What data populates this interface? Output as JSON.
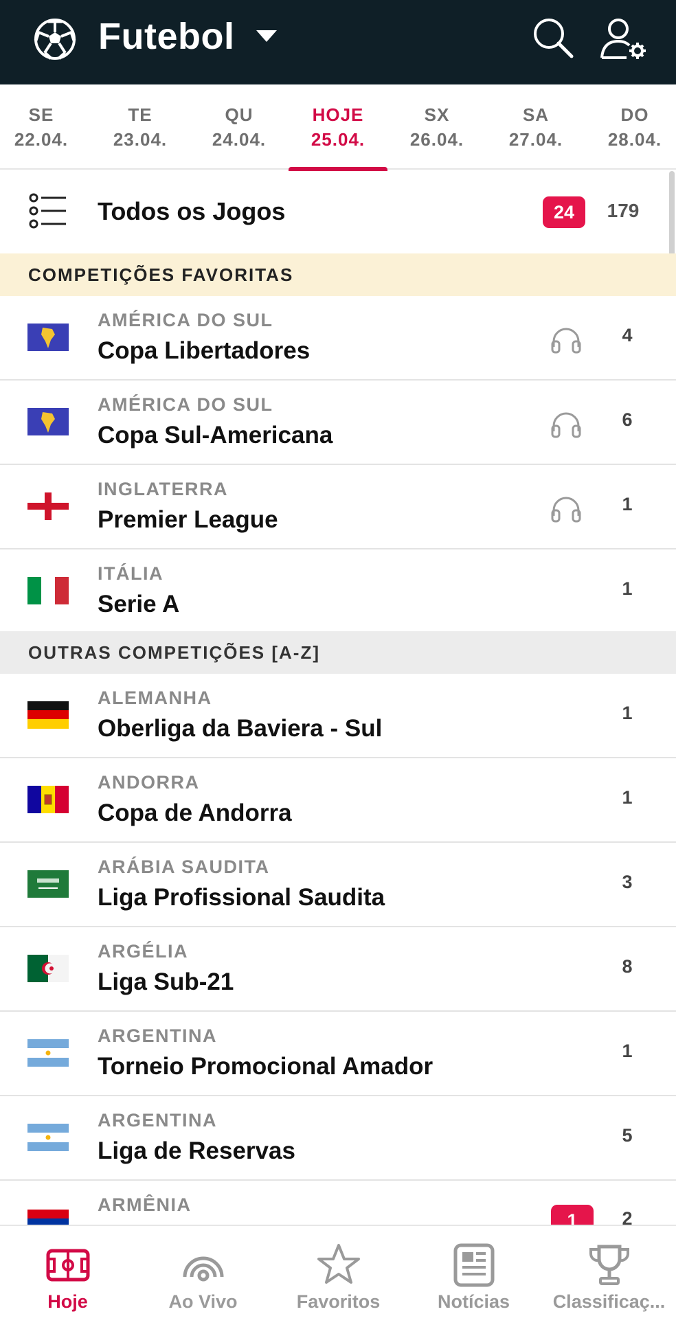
{
  "header": {
    "title": "Futebol"
  },
  "dates": [
    {
      "weekday": "SE",
      "date": "22.04.",
      "active": false
    },
    {
      "weekday": "TE",
      "date": "23.04.",
      "active": false
    },
    {
      "weekday": "QU",
      "date": "24.04.",
      "active": false
    },
    {
      "weekday": "HOJE",
      "date": "25.04.",
      "active": true
    },
    {
      "weekday": "SX",
      "date": "26.04.",
      "active": false
    },
    {
      "weekday": "SA",
      "date": "27.04.",
      "active": false
    },
    {
      "weekday": "DO",
      "date": "28.04.",
      "active": false
    }
  ],
  "all_games": {
    "label": "Todos os Jogos",
    "live": "24",
    "total": "179"
  },
  "favorites": {
    "title": "COMPETIÇÕES FAVORITAS",
    "items": [
      {
        "country": "AMÉRICA DO SUL",
        "name": "Copa Libertadores",
        "count": "4",
        "audio": true,
        "flag": "south-america"
      },
      {
        "country": "AMÉRICA DO SUL",
        "name": "Copa Sul-Americana",
        "count": "6",
        "audio": true,
        "flag": "south-america"
      },
      {
        "country": "INGLATERRA",
        "name": "Premier League",
        "count": "1",
        "audio": true,
        "flag": "england"
      },
      {
        "country": "ITÁLIA",
        "name": "Serie A",
        "count": "1",
        "audio": false,
        "flag": "italy"
      }
    ]
  },
  "others": {
    "title": "OUTRAS COMPETIÇÕES [A-Z]",
    "items": [
      {
        "country": "ALEMANHA",
        "name": "Oberliga da Baviera - Sul",
        "count": "1",
        "flag": "germany"
      },
      {
        "country": "ANDORRA",
        "name": "Copa de Andorra",
        "count": "1",
        "flag": "andorra"
      },
      {
        "country": "ARÁBIA SAUDITA",
        "name": "Liga Profissional Saudita",
        "count": "3",
        "flag": "saudi-arabia"
      },
      {
        "country": "ARGÉLIA",
        "name": "Liga Sub-21",
        "count": "8",
        "flag": "algeria"
      },
      {
        "country": "ARGENTINA",
        "name": "Torneio Promocional Amador",
        "count": "1",
        "flag": "argentina"
      },
      {
        "country": "ARGENTINA",
        "name": "Liga de Reservas",
        "count": "5",
        "flag": "argentina"
      },
      {
        "country": "ARMÊNIA",
        "name": "",
        "count": "2",
        "live": "1",
        "flag": "armenia"
      }
    ]
  },
  "nav": [
    {
      "label": "Hoje",
      "icon": "pitch-icon",
      "active": true
    },
    {
      "label": "Ao Vivo",
      "icon": "live-icon",
      "active": false
    },
    {
      "label": "Favoritos",
      "icon": "star-icon",
      "active": false
    },
    {
      "label": "Notícias",
      "icon": "news-icon",
      "active": false
    },
    {
      "label": "Classificaç...",
      "icon": "trophy-icon",
      "active": false
    }
  ],
  "colors": {
    "header_bg": "#0f1f27",
    "accent": "#d20a46",
    "badge": "#e5154b",
    "fav_bg": "#fbf1d6"
  }
}
